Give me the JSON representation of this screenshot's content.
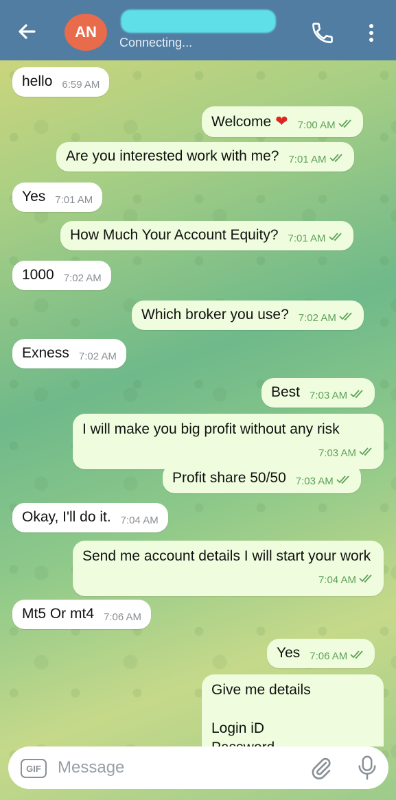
{
  "header": {
    "avatar_initials": "AN",
    "status": "Connecting...",
    "colors": {
      "bar": "#517da2",
      "avatar": "#e86b4c"
    }
  },
  "messages": [
    {
      "dir": "in",
      "text": "hello",
      "time": "6:59 AM"
    },
    {
      "dir": "out",
      "text": "Welcome",
      "emoji": "❤️",
      "time": "7:00 AM"
    },
    {
      "dir": "out",
      "text": "Are you interested work with me?",
      "time": "7:01 AM"
    },
    {
      "dir": "in",
      "text": "Yes",
      "time": "7:01 AM"
    },
    {
      "dir": "out",
      "text": "How Much Your Account Equity?",
      "time": "7:01 AM"
    },
    {
      "dir": "in",
      "text": "1000",
      "time": "7:02 AM"
    },
    {
      "dir": "out",
      "text": "Which broker you use?",
      "time": "7:02 AM"
    },
    {
      "dir": "in",
      "text": "Exness",
      "time": "7:02 AM"
    },
    {
      "dir": "out",
      "text": "Best",
      "time": "7:03 AM"
    },
    {
      "dir": "out",
      "text": "I will make you big profit without any risk",
      "time": "7:03 AM"
    },
    {
      "dir": "out",
      "text": "Profit share 50/50",
      "time": "7:03 AM"
    },
    {
      "dir": "in",
      "text": "Okay, I'll do it.",
      "time": "7:04 AM"
    },
    {
      "dir": "out",
      "text": "Send me account details I will start your work",
      "time": "7:04 AM"
    },
    {
      "dir": "in",
      "text": "Mt5 Or mt4",
      "time": "7:06 AM"
    },
    {
      "dir": "out",
      "text": "Yes",
      "time": "7:06 AM"
    },
    {
      "dir": "out",
      "text_line1": "Give me details",
      "text_line2": "Login iD",
      "text_line3": "Password"
    }
  ],
  "input": {
    "gif_label": "GIF",
    "placeholder": "Message"
  },
  "icons": [
    "back-arrow-icon",
    "phone-icon",
    "more-vert-icon",
    "double-check-icon",
    "gif-icon",
    "paperclip-icon",
    "microphone-icon"
  ]
}
